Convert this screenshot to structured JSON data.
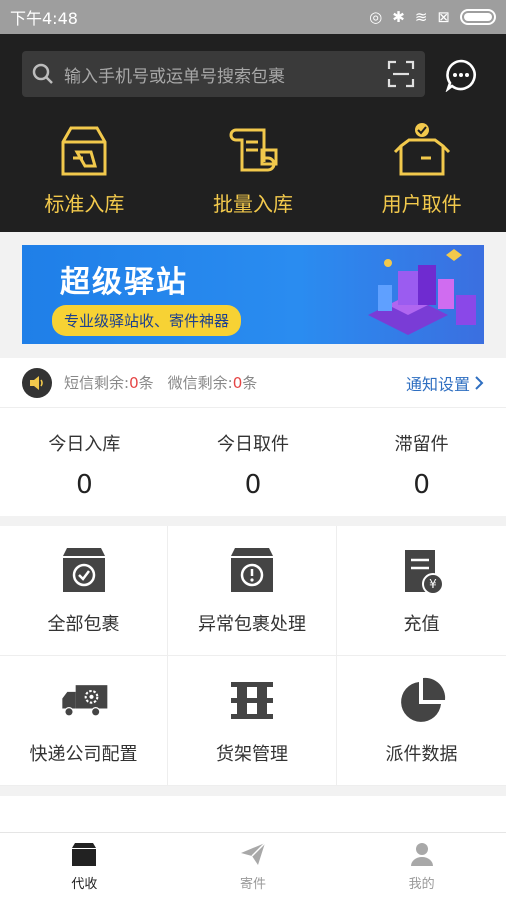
{
  "status_bar": {
    "time": "下午4:48"
  },
  "header": {
    "search": {
      "placeholder": "输入手机号或运单号搜索包裹"
    },
    "actions": [
      {
        "label": "标准入库",
        "icon": "box-scan-icon"
      },
      {
        "label": "批量入库",
        "icon": "scroll-box-icon"
      },
      {
        "label": "用户取件",
        "icon": "box-check-icon"
      }
    ],
    "accent_color": "#f2c94c"
  },
  "banner": {
    "title": "超级驿站",
    "subtitle": "专业级驿站收、寄件神器"
  },
  "notice": {
    "sms_label": "短信剩余:",
    "sms_count": "0",
    "sms_unit": "条",
    "wechat_label": "微信剩余:",
    "wechat_count": "0",
    "wechat_unit": "条",
    "settings_label": "通知设置"
  },
  "stats": [
    {
      "label": "今日入库",
      "value": "0"
    },
    {
      "label": "今日取件",
      "value": "0"
    },
    {
      "label": "滞留件",
      "value": "0"
    }
  ],
  "grid": [
    {
      "label": "全部包裹",
      "icon": "package-check-icon"
    },
    {
      "label": "异常包裹处理",
      "icon": "package-alert-icon"
    },
    {
      "label": "充值",
      "icon": "recharge-icon"
    },
    {
      "label": "快递公司配置",
      "icon": "truck-gear-icon"
    },
    {
      "label": "货架管理",
      "icon": "shelf-icon"
    },
    {
      "label": "派件数据",
      "icon": "pie-chart-icon"
    }
  ],
  "tabs": [
    {
      "label": "代收",
      "icon": "box-icon",
      "active": true
    },
    {
      "label": "寄件",
      "icon": "paper-plane-icon",
      "active": false
    },
    {
      "label": "我的",
      "icon": "user-icon",
      "active": false
    }
  ]
}
